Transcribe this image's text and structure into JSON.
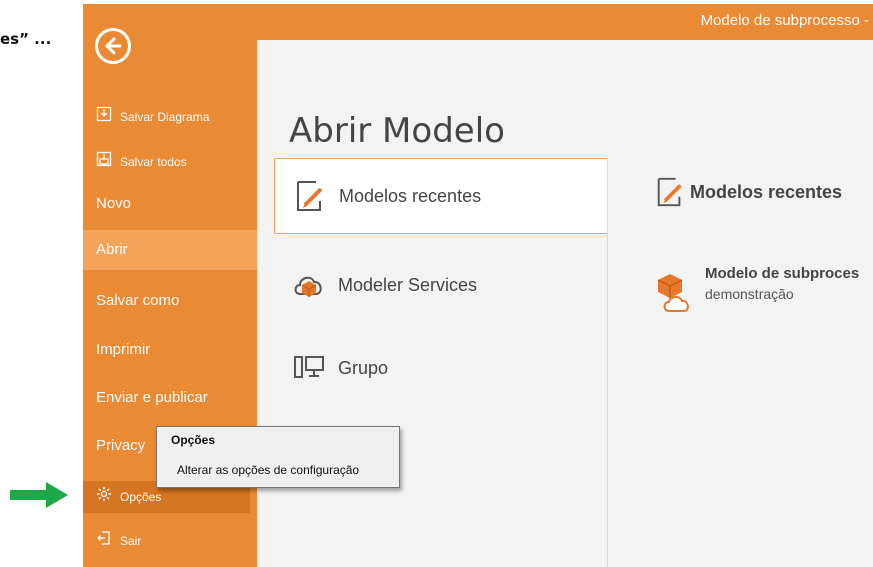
{
  "doc_fragment": "es” ...",
  "window": {
    "title": "Modelo de subprocesso -"
  },
  "sidebar": {
    "items": [
      {
        "label": "Salvar Diagrama",
        "icon": "save-diagram-icon"
      },
      {
        "label": "Salvar todos",
        "icon": "save-all-icon"
      },
      {
        "label": "Novo"
      },
      {
        "label": "Abrir",
        "state": "selected"
      },
      {
        "label": "Salvar como"
      },
      {
        "label": "Imprimir"
      },
      {
        "label": "Enviar e publicar"
      },
      {
        "label": "Privacy"
      },
      {
        "label": "Opções",
        "icon": "gear-icon",
        "state": "hover"
      },
      {
        "label": "Sair",
        "icon": "exit-icon"
      }
    ]
  },
  "main": {
    "title": "Abrir Modelo",
    "options": [
      {
        "label": "Modelos recentes",
        "icon": "edit-document-icon",
        "selected": true
      },
      {
        "label": "Modeler Services",
        "icon": "cloud-cube-icon"
      },
      {
        "label": "Grupo",
        "icon": "server-monitor-icon"
      }
    ],
    "recent": {
      "header": "Modelos recentes",
      "items": [
        {
          "name": "Modelo de subproces",
          "subtitle": "demonstração",
          "icon": "cloud-cube-icon"
        }
      ]
    }
  },
  "tooltip": {
    "title": "Opções",
    "description": "Alterar as opções de configuração"
  },
  "colors": {
    "accent": "#ea8a35",
    "accent_light": "#f5a25a",
    "accent_dark": "#d57421",
    "arrow": "#1ea84a"
  }
}
